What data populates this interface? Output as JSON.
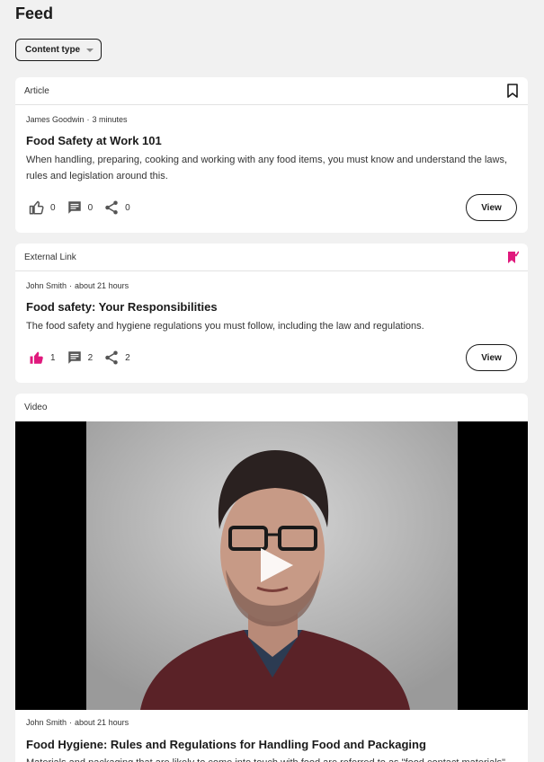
{
  "page": {
    "title": "Feed"
  },
  "filter": {
    "label": "Content type"
  },
  "cards": [
    {
      "type": "Article",
      "author": "James Goodwin",
      "time": "3 minutes",
      "title": "Food Safety at Work 101",
      "description": "When handling, preparing, cooking and working with any food items, you must know and understand the laws, rules and legislation around this.",
      "likes": "0",
      "comments": "0",
      "shares": "0",
      "view_label": "View",
      "liked": false,
      "bookmarked": false
    },
    {
      "type": "External Link",
      "author": "John Smith",
      "time": "about 21 hours",
      "title": "Food safety: Your Responsibilities",
      "description": "The food safety and hygiene regulations you must follow, including the law and regulations.",
      "likes": "1",
      "comments": "2",
      "shares": "2",
      "view_label": "View",
      "liked": true,
      "bookmarked": true
    },
    {
      "type": "Video",
      "author": "John Smith",
      "time": "about 21 hours",
      "title": "Food Hygiene: Rules and Regulations for Handling Food and Packaging",
      "description": "Materials and packaging that are likely to come into touch with food are referred to as \"food contact materials\"."
    }
  ],
  "separator": "·",
  "colors": {
    "accent": "#e0197d",
    "background": "#f1f1f1",
    "card": "#ffffff",
    "text": "#1a1a1a"
  }
}
